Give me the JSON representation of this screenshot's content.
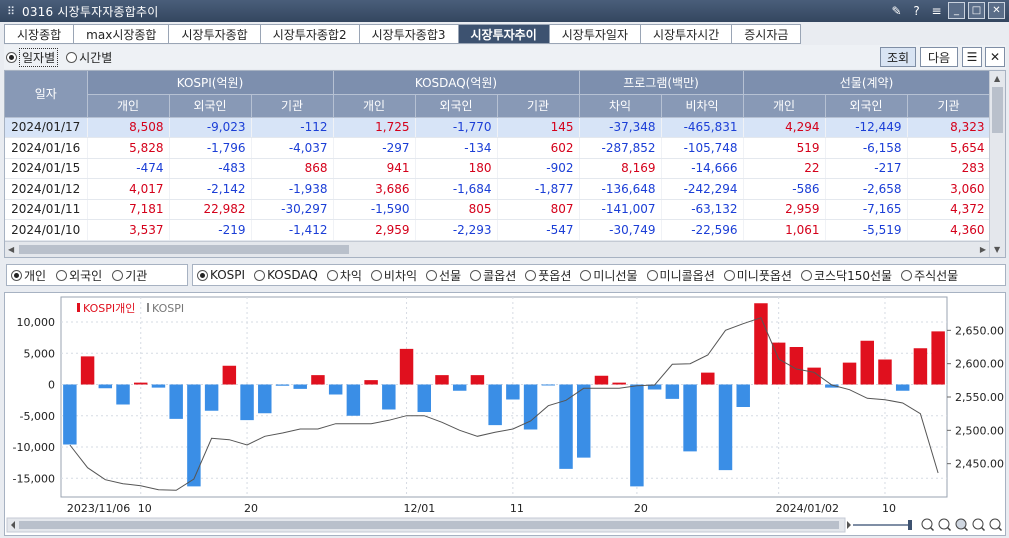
{
  "window": {
    "icon": "grid-menu-icon",
    "title": "0316 시장투자자종합추이"
  },
  "tabs": [
    {
      "label": "시장종합",
      "active": false
    },
    {
      "label": "max시장종합",
      "active": false
    },
    {
      "label": "시장투자종합",
      "active": false
    },
    {
      "label": "시장투자종합2",
      "active": false
    },
    {
      "label": "시장투자종합3",
      "active": false
    },
    {
      "label": "시장투자추이",
      "active": true
    },
    {
      "label": "시장투자일자",
      "active": false
    },
    {
      "label": "시장투자시간",
      "active": false
    },
    {
      "label": "증시자금",
      "active": false
    }
  ],
  "toolbar": {
    "mode_daily": "일자별",
    "mode_time": "시간별",
    "query_button": "조회",
    "next_button": "다음"
  },
  "table": {
    "date_header": "일자",
    "groups": [
      "KOSPI(억원)",
      "KOSDAQ(억원)",
      "프로그램(백만)",
      "선물(계약)"
    ],
    "subheaders": [
      "개인",
      "외국인",
      "기관",
      "개인",
      "외국인",
      "기관",
      "차익",
      "비차익",
      "개인",
      "외국인",
      "기관"
    ],
    "rows": [
      {
        "date": "2024/01/17",
        "cells": [
          "8,508",
          "-9,023",
          "-112",
          "1,725",
          "-1,770",
          "145",
          "-37,348",
          "-465,831",
          "4,294",
          "-12,449",
          "8,323"
        ]
      },
      {
        "date": "2024/01/16",
        "cells": [
          "5,828",
          "-1,796",
          "-4,037",
          "-297",
          "-134",
          "602",
          "-287,852",
          "-105,748",
          "519",
          "-6,158",
          "5,654"
        ]
      },
      {
        "date": "2024/01/15",
        "cells": [
          "-474",
          "-483",
          "868",
          "941",
          "180",
          "-902",
          "8,169",
          "-14,666",
          "22",
          "-217",
          "283"
        ]
      },
      {
        "date": "2024/01/12",
        "cells": [
          "4,017",
          "-2,142",
          "-1,938",
          "3,686",
          "-1,684",
          "-1,877",
          "-136,648",
          "-242,294",
          "-586",
          "-2,658",
          "3,060"
        ]
      },
      {
        "date": "2024/01/11",
        "cells": [
          "7,181",
          "22,982",
          "-30,297",
          "-1,590",
          "805",
          "807",
          "-141,007",
          "-63,132",
          "2,959",
          "-7,165",
          "4,372"
        ]
      },
      {
        "date": "2024/01/10",
        "cells": [
          "3,537",
          "-219",
          "-1,412",
          "2,959",
          "-2,293",
          "-547",
          "-30,749",
          "-22,596",
          "1,061",
          "-5,519",
          "4,360"
        ]
      }
    ]
  },
  "investor_filters": [
    {
      "label": "개인",
      "checked": true
    },
    {
      "label": "외국인",
      "checked": false
    },
    {
      "label": "기관",
      "checked": false
    }
  ],
  "market_filters": [
    {
      "label": "KOSPI",
      "checked": true
    },
    {
      "label": "KOSDAQ",
      "checked": false
    },
    {
      "label": "차익",
      "checked": false
    },
    {
      "label": "비차익",
      "checked": false
    },
    {
      "label": "선물",
      "checked": false
    },
    {
      "label": "콜옵션",
      "checked": false
    },
    {
      "label": "풋옵션",
      "checked": false
    },
    {
      "label": "미니선물",
      "checked": false
    },
    {
      "label": "미니콜옵션",
      "checked": false
    },
    {
      "label": "미니풋옵션",
      "checked": false
    },
    {
      "label": "코스닥150선물",
      "checked": false
    },
    {
      "label": "주식선물",
      "checked": false
    }
  ],
  "colors": {
    "positive": "#e0101e",
    "negative": "#3a8ee6",
    "line": "#555555",
    "header": "#8899b6",
    "tab_active": "#3d5270"
  },
  "chart_data": {
    "type": "bar",
    "legend": [
      "KOSPI개인",
      "KOSPI"
    ],
    "y_left": {
      "ticks": [
        "10,000",
        "5,000",
        "0",
        "-5,000",
        "-10,000",
        "-15,000"
      ],
      "range": [
        -18000,
        14000
      ]
    },
    "y_right": {
      "ticks": [
        "2,650.00",
        "2,600.00",
        "2,550.00",
        "2,500.00",
        "2,450.00"
      ],
      "range": [
        2400,
        2700
      ]
    },
    "x_labels": [
      {
        "label": "2023/11/06",
        "index": 0
      },
      {
        "label": "10",
        "index": 4
      },
      {
        "label": "20",
        "index": 10
      },
      {
        "label": "12/01",
        "index": 19
      },
      {
        "label": "11",
        "index": 25
      },
      {
        "label": "20",
        "index": 32
      },
      {
        "label": "2024/01/02",
        "index": 40
      },
      {
        "label": "10",
        "index": 46
      }
    ],
    "series": [
      {
        "name": "KOSPI개인",
        "values": [
          -9600,
          4500,
          -600,
          -3200,
          300,
          -500,
          -5500,
          -16300,
          -4200,
          3000,
          -5700,
          -4600,
          -200,
          -700,
          1500,
          -1600,
          -5000,
          700,
          -4000,
          5700,
          -4400,
          1500,
          -1000,
          1500,
          -6500,
          -2400,
          -7200,
          -100,
          -13500,
          -11700,
          1400,
          300,
          -16300,
          -800,
          -2300,
          -10700,
          1900,
          -13700,
          -3600,
          13000,
          6700,
          6000,
          2700,
          -500,
          3500,
          7000,
          4000,
          -1000,
          5800,
          8500
        ]
      },
      {
        "name": "KOSPI",
        "values": [
          2478,
          2444,
          2426,
          2420,
          2417,
          2411,
          2410,
          2427,
          2488,
          2486,
          2478,
          2491,
          2496,
          2502,
          2502,
          2510,
          2510,
          2510,
          2515,
          2522,
          2522,
          2512,
          2500,
          2491,
          2497,
          2502,
          2514,
          2537,
          2545,
          2563,
          2563,
          2563,
          2567,
          2568,
          2599,
          2600,
          2613,
          2650,
          2660,
          2669,
          2607,
          2592,
          2587,
          2568,
          2561,
          2548,
          2546,
          2541,
          2525,
          2436
        ]
      }
    ]
  }
}
